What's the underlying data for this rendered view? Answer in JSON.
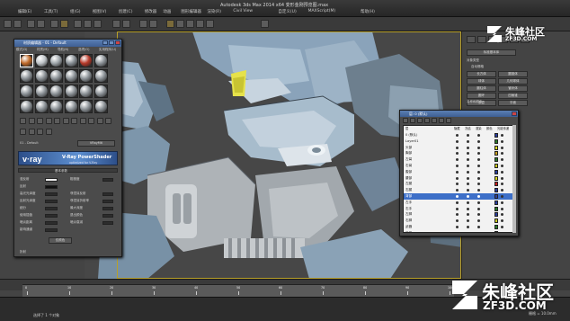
{
  "window": {
    "title": "Autodesk 3ds Max 2014 x64",
    "file_title": "变形金刚预览图.max"
  },
  "menu": {
    "items": [
      "编辑(E)",
      "工具(T)",
      "组(G)",
      "视图(V)",
      "创建(C)",
      "修改器",
      "动画",
      "图形编辑器",
      "渲染(R)",
      "Civil View",
      "自定义(U)",
      "MAXScript(M)",
      "帮助(H)"
    ],
    "workspace": "Workspace: 默认"
  },
  "material_editor": {
    "title": "材质编辑器 - 01 - Default",
    "menu": [
      "模式(D)",
      "材质(M)",
      "导航(N)",
      "选项(O)",
      "实用程序(U)"
    ],
    "material_name": "01 - Default",
    "material_type": "VRayMtl",
    "vray_logo": "v·ray",
    "vray_title": "V-Ray PowerShader",
    "vray_subtitle": "optimized for V-Ray",
    "rollout_basic": "基本参数",
    "params": [
      {
        "label": "漫反射",
        "extra": "粗糙度"
      },
      {
        "label": "反射"
      },
      {
        "label": "高光光泽度",
        "extra": "菲涅耳反射"
      },
      {
        "label": "反射光泽度",
        "extra": "菲涅耳折射率"
      },
      {
        "label": "细分",
        "extra": "最大深度"
      },
      {
        "label": "使用插值",
        "extra": "退出颜色"
      },
      {
        "label": "暗淡距离",
        "extra": "暗淡衰减"
      },
      {
        "label": "影响通道"
      }
    ],
    "channel_value": "仅颜色",
    "rollout_refraction": "折射"
  },
  "layer_window": {
    "title": "层: 0 (默认)",
    "columns": [
      "层",
      "隐藏",
      "冻结",
      "渲染",
      "颜色",
      "光能传递"
    ],
    "rows": [
      {
        "name": "0 (默认)",
        "color": "#2b3fa0",
        "selected": false
      },
      {
        "name": "Layer01",
        "color": "#2b7a2b",
        "selected": false
      },
      {
        "name": "头部",
        "color": "#d8d820",
        "selected": false
      },
      {
        "name": "胸部",
        "color": "#c8a020",
        "selected": false
      },
      {
        "name": "左臂",
        "color": "#2b7a2b",
        "selected": false
      },
      {
        "name": "右臂",
        "color": "#c8c820",
        "selected": false
      },
      {
        "name": "腹部",
        "color": "#2b3fa0",
        "selected": false
      },
      {
        "name": "腰部",
        "color": "#d8d820",
        "selected": false
      },
      {
        "name": "左腿",
        "color": "#c82020",
        "selected": false
      },
      {
        "name": "右腿",
        "color": "#2b3fa0",
        "selected": false
      },
      {
        "name": "背部",
        "color": "#2b3fa0",
        "selected": true
      },
      {
        "name": "左手",
        "color": "#2b3fa0",
        "selected": false
      },
      {
        "name": "右手",
        "color": "#2b7a2b",
        "selected": false
      },
      {
        "name": "左脚",
        "color": "#2b3fa0",
        "selected": false
      },
      {
        "name": "右脚",
        "color": "#c8c820",
        "selected": false
      },
      {
        "name": "武器",
        "color": "#2b7a2b",
        "selected": false
      },
      {
        "name": "肩甲",
        "color": "#2b3fa0",
        "selected": false
      }
    ]
  },
  "command_panel": {
    "object_type": "对象类型",
    "autogrid": "自动栅格",
    "buttons": [
      "标准基本体",
      "长方体",
      "圆锥体",
      "球体",
      "几何球体",
      "圆柱体",
      "管状体",
      "圆环",
      "四棱锥",
      "茶壶",
      "平面"
    ],
    "name_color": "名称和颜色"
  },
  "timeline": {
    "frame_label": "0 / 100",
    "ticks": [
      "0",
      "10",
      "20",
      "30",
      "40",
      "50",
      "60",
      "70",
      "80",
      "90",
      "100"
    ]
  },
  "status": {
    "text": "选择了 1 个对象",
    "zoom": "栅格 = 10.0mm"
  },
  "watermark": {
    "name": "朱峰社区",
    "url": "ZF3D.COM"
  },
  "colors": {
    "accent": "#5b7fb3",
    "viewport_border": "#b8a02a",
    "selection": "#3d6fc8"
  }
}
